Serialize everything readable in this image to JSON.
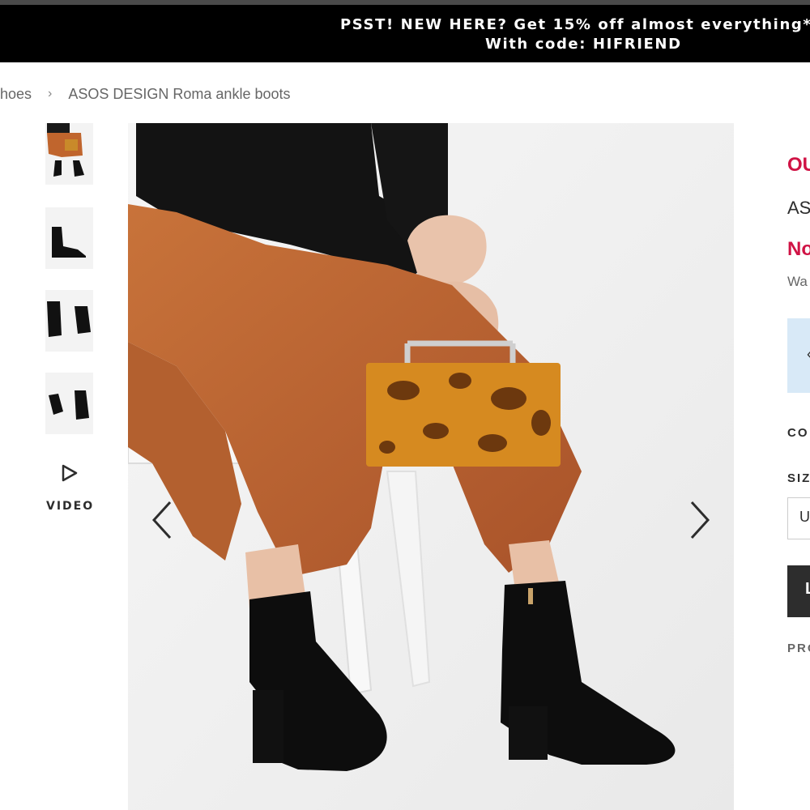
{
  "promo": {
    "line1": "PSST! NEW HERE? Get 15% off almost everything*",
    "line2": "With code: HIFRIEND"
  },
  "breadcrumb": {
    "parent": "hoes",
    "separator": "›",
    "current": "ASOS DESIGN Roma ankle boots"
  },
  "gallery": {
    "video_label": "VIDEO",
    "prev_icon": "chevron-left-icon",
    "next_icon": "chevron-right-icon",
    "play_icon": "play-icon"
  },
  "product": {
    "status": "OU",
    "brand": "AS",
    "price": "No",
    "was_price": "Wa",
    "colour_label": "CO",
    "size_label": "SIZ",
    "size_select_value": "U",
    "add_button_label": "L",
    "promo_label": "PRO"
  },
  "colors": {
    "accent": "#d01345",
    "promo_bg": "#000000",
    "button_bg": "#2d2d2d",
    "info_bg": "#d8e9f7"
  }
}
